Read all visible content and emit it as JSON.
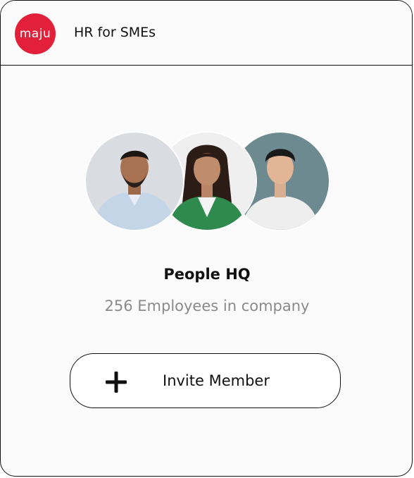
{
  "header": {
    "logo_text": "maju",
    "app_name": "HR for SMEs"
  },
  "team": {
    "avatars": [
      {
        "name": "avatar-man-blue-shirt"
      },
      {
        "name": "avatar-woman-green-cardigan"
      },
      {
        "name": "avatar-man-white-tee"
      }
    ],
    "company_name": "People HQ",
    "employee_count_text": "256 Employees in company"
  },
  "actions": {
    "invite_label": "Invite Member",
    "invite_icon": "plus-icon"
  },
  "colors": {
    "brand": "#e3203a",
    "muted_text": "#8a8a8a",
    "border": "#111111"
  }
}
